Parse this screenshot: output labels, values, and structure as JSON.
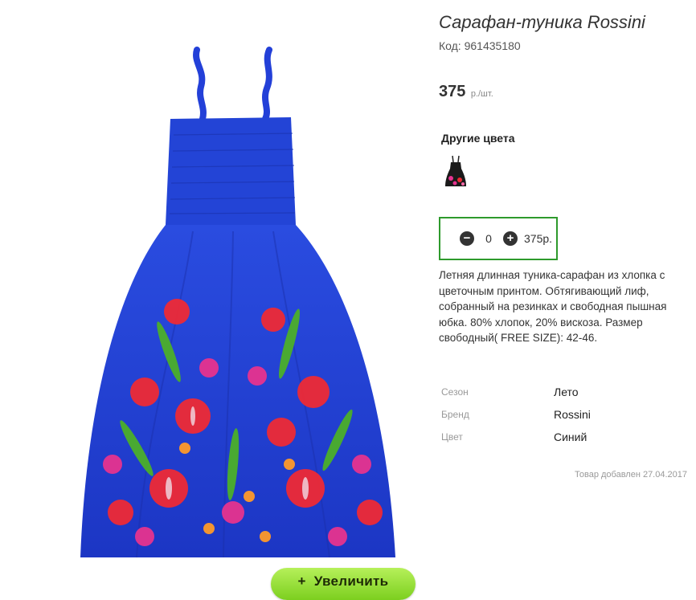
{
  "product": {
    "title": "Сарафан-туника Rossini",
    "code": "Код: 961435180",
    "price_value": "375",
    "price_unit": "р./шт."
  },
  "other_colors": {
    "title": "Другие цвета"
  },
  "quantity": {
    "minus_icon": "minus-circle-icon",
    "value": "0",
    "plus_icon": "plus-circle-icon",
    "sum": "375р."
  },
  "description": "Летняя длинная туника-сарафан из хлопка с цветочным принтом. Обтягивающий лиф, собранный на резинках и свободная пышная юбка. 80% хлопок, 20% вискоза. Размер свободный( FREE SIZE): 42-46.",
  "properties": [
    {
      "key": "Сезон",
      "value": "Лето"
    },
    {
      "key": "Бренд",
      "value": "Rossini"
    },
    {
      "key": "Цвет",
      "value": "Синий"
    }
  ],
  "added_note": "Товар добавлен 27.04.2017",
  "zoom_button": {
    "plus": "+",
    "label": "Увеличить"
  },
  "colors": {
    "dress_blue": "#1f3fd0",
    "qty_border": "#2e9a2c",
    "zoom_green": "#8fdc2c"
  }
}
